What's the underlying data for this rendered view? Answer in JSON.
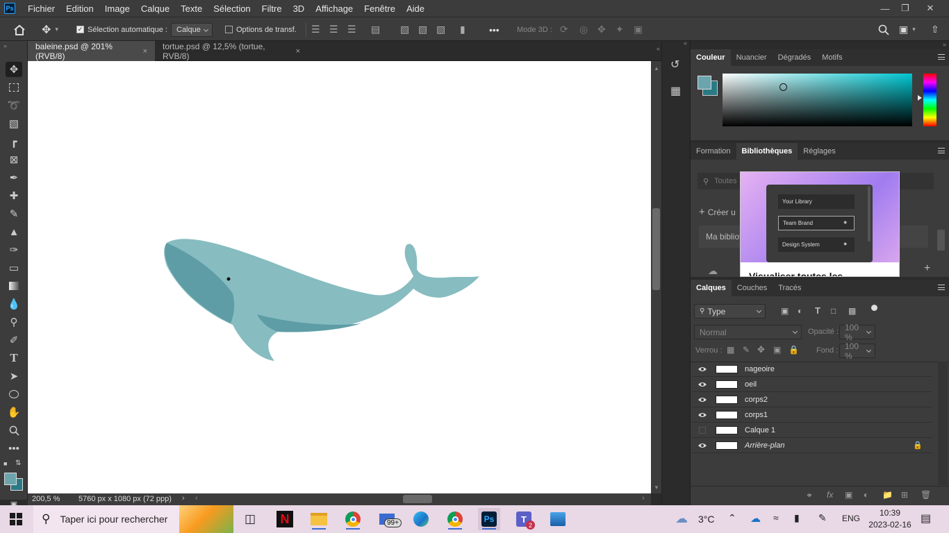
{
  "app": {
    "logo": "Ps"
  },
  "menu": [
    "Fichier",
    "Edition",
    "Image",
    "Calque",
    "Texte",
    "Sélection",
    "Filtre",
    "3D",
    "Affichage",
    "Fenêtre",
    "Aide"
  ],
  "options": {
    "auto_select_label": "Sélection automatique :",
    "auto_select_value": "Calque",
    "transform_label": "Options de transf.",
    "mode3d_label": "Mode 3D :",
    "more": "•••"
  },
  "tabs": [
    {
      "label": "baleine.psd @ 201% (RVB/8)",
      "close": "×"
    },
    {
      "label": "tortue.psd @ 12,5% (tortue, RVB/8)",
      "close": "×"
    }
  ],
  "status": {
    "zoom": "200,5 %",
    "size": "5760 px x 1080 px (72 ppp)"
  },
  "colors": {
    "foreground": "#6ba4ad",
    "background": "#2a7a86"
  },
  "color_panel": {
    "tabs": [
      "Couleur",
      "Nuancier",
      "Dégradés",
      "Motifs"
    ]
  },
  "libraries_panel": {
    "tabs": [
      "Formation",
      "Bibliothèques",
      "Réglages"
    ],
    "search_placeholder": "Toutes",
    "create_label": "Créer u",
    "my_library": "Ma bibliot",
    "popup": {
      "items": [
        "Your Library",
        "Team Brand",
        "Design System"
      ],
      "title": "Visualiser toutes les"
    }
  },
  "layers_panel": {
    "tabs": [
      "Calques",
      "Couches",
      "Tracés"
    ],
    "filter_label": "Type",
    "blend_mode": "Normal",
    "opacity_label": "Opacité :",
    "opacity_value": "100 %",
    "lock_label": "Verrou :",
    "fill_label": "Fond :",
    "fill_value": "100 %",
    "layers": [
      {
        "name": "nageoire",
        "visible": true
      },
      {
        "name": "oeil",
        "visible": true
      },
      {
        "name": "corps2",
        "visible": true
      },
      {
        "name": "corps1",
        "visible": true
      },
      {
        "name": "Calque 1",
        "visible": false
      },
      {
        "name": "Arrière-plan",
        "visible": true,
        "locked": true
      }
    ],
    "footer_icons": [
      "link-icon",
      "fx-icon",
      "mask-icon",
      "adjustment-icon",
      "group-icon",
      "new-layer-icon",
      "trash-icon"
    ]
  },
  "taskbar": {
    "search_placeholder": "Taper ici pour rechercher",
    "weather": "3°C",
    "language": "ENG",
    "time": "10:39",
    "date": "2023-02-16",
    "mail_badge": "99+",
    "teams_badge": "2"
  }
}
